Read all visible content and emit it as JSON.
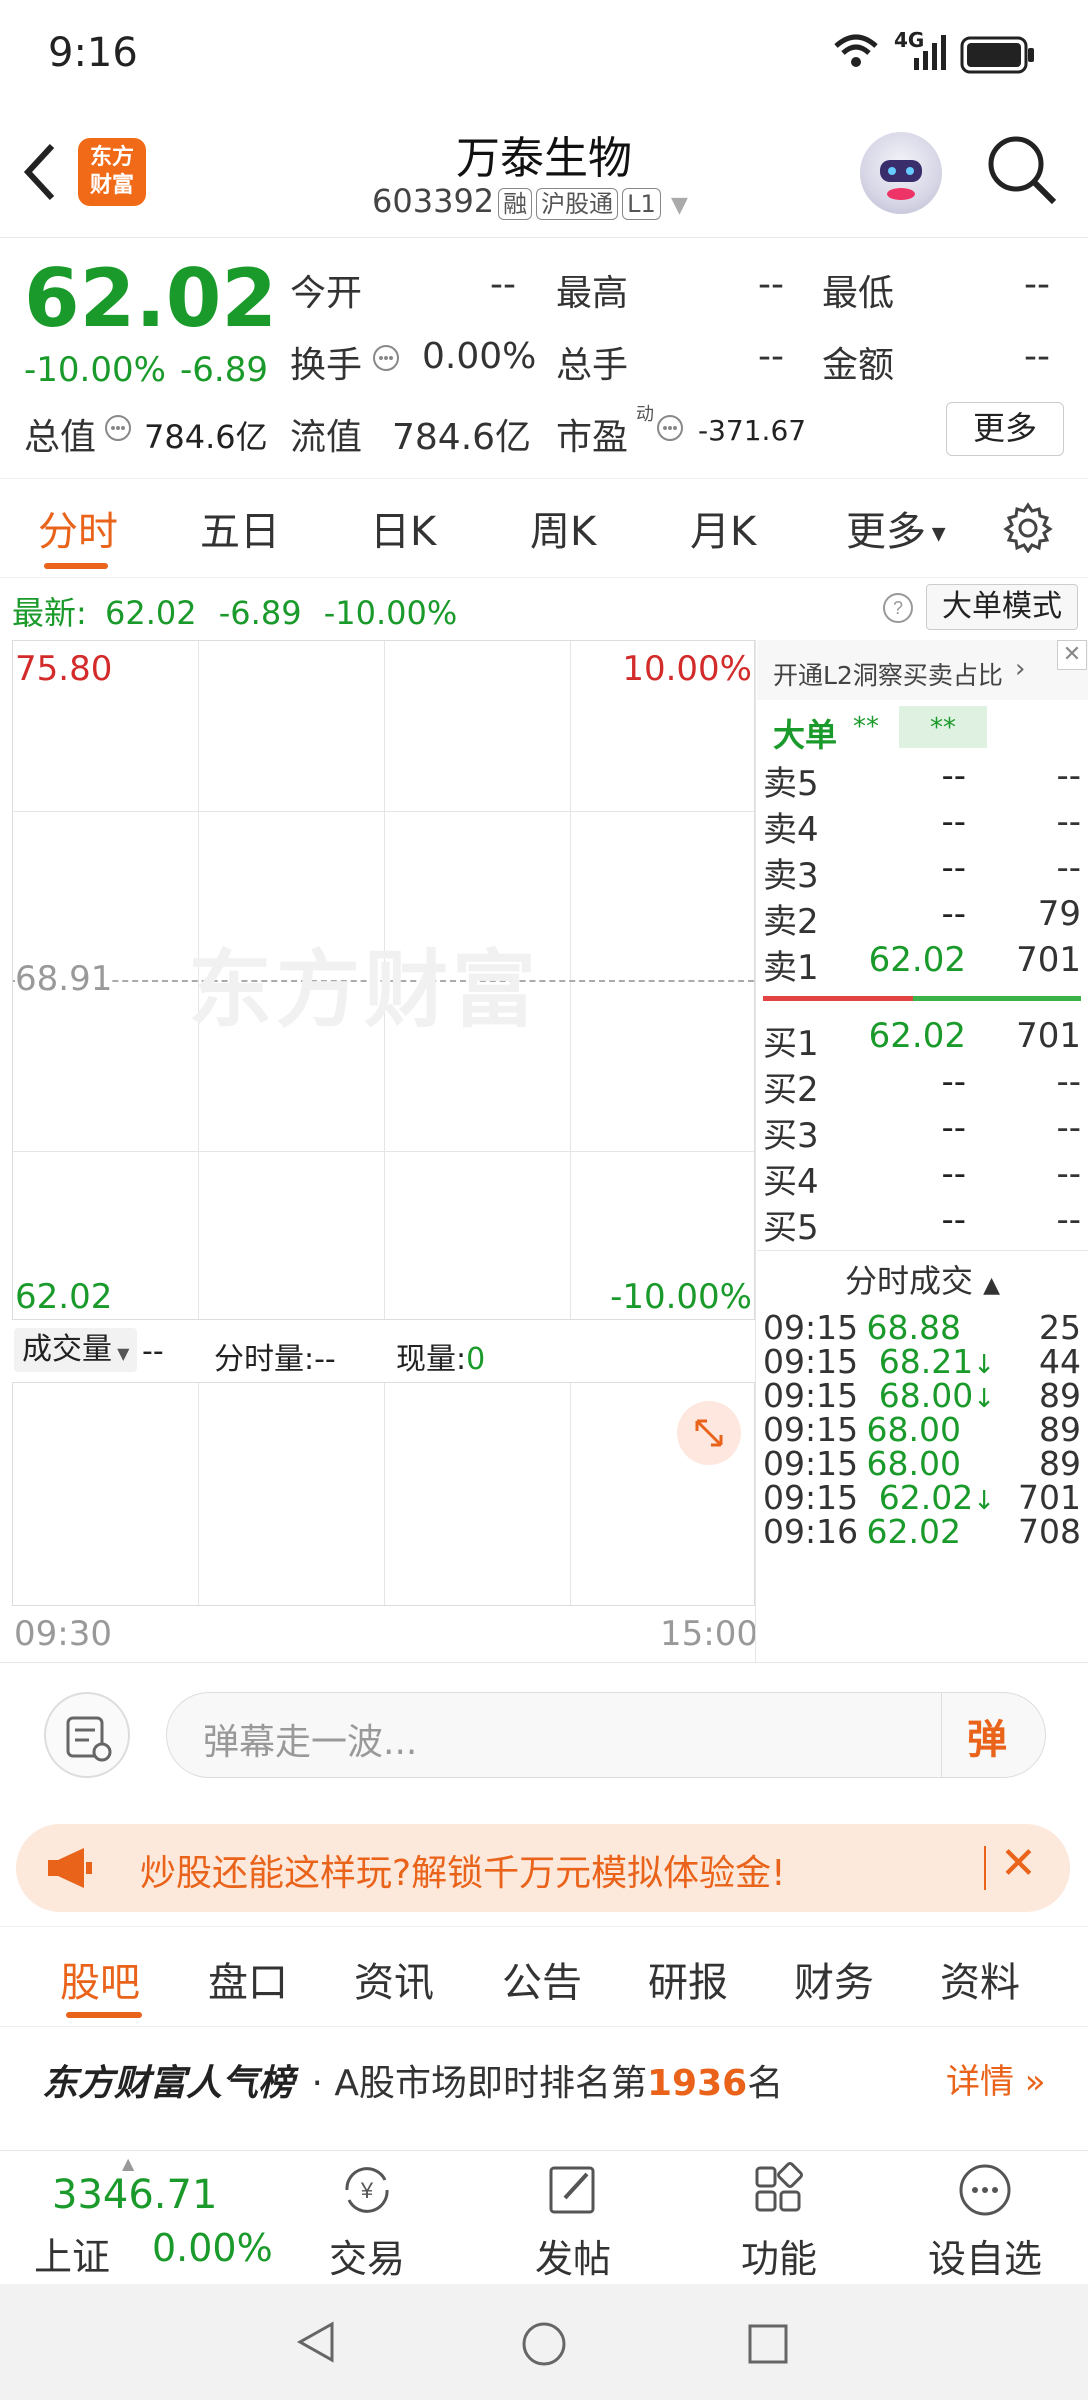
{
  "status_bar": {
    "time": "9:16",
    "network": "4G"
  },
  "header": {
    "title": "万泰生物",
    "code": "603392",
    "tags": [
      "融",
      "沪股通",
      "L1"
    ],
    "logo_text": "东方财富"
  },
  "quote": {
    "price": "62.02",
    "change_pct": "-10.00%",
    "change": "-6.89",
    "open_label": "今开",
    "open_value": "--",
    "high_label": "最高",
    "high_value": "--",
    "low_label": "最低",
    "low_value": "--",
    "turnover_label": "换手",
    "turnover_value": "0.00%",
    "volume_label": "总手",
    "volume_value": "--",
    "amount_label": "金额",
    "amount_value": "--",
    "mcap_label": "总值",
    "mcap_value": "784.6亿",
    "float_label": "流值",
    "float_value": "784.6亿",
    "pe_label": "市盈",
    "pe_sup": "动",
    "pe_value": "-371.67",
    "more_button": "更多"
  },
  "tabs": [
    "分时",
    "五日",
    "日K",
    "周K",
    "月K",
    "更多"
  ],
  "latest_bar": {
    "label": "最新:",
    "price": "62.02",
    "change": "-6.89",
    "pct": "-10.00%",
    "mode_button": "大单模式"
  },
  "chart": {
    "y_max": "75.80",
    "y_mid": "68.91",
    "y_min": "62.02",
    "pct_max": "10.00%",
    "pct_min": "-10.00%",
    "watermark": "东方财富",
    "time_start": "09:30",
    "time_end": "15:00",
    "volume_dropdown": "成交量",
    "volume_value": "--",
    "minute_volume_label": "分时量:",
    "minute_volume_value": "--",
    "current_volume_label": "现量:",
    "current_volume_value": "0"
  },
  "chart_data": {
    "type": "line",
    "title": "",
    "xlabel": "",
    "ylabel": "",
    "x_range": [
      "09:30",
      "15:00"
    ],
    "ylim": [
      62.02,
      75.8
    ],
    "reference_line": 68.91,
    "series": []
  },
  "order_book": {
    "l2_banner": "开通L2洞察买卖占比",
    "big_order_label": "大单",
    "big_order_v1": "**",
    "big_order_v2": "**",
    "asks": [
      {
        "label": "卖5",
        "price": "--",
        "vol": "--"
      },
      {
        "label": "卖4",
        "price": "--",
        "vol": "--"
      },
      {
        "label": "卖3",
        "price": "--",
        "vol": "--"
      },
      {
        "label": "卖2",
        "price": "--",
        "vol": "79"
      },
      {
        "label": "卖1",
        "price": "62.02",
        "vol": "701"
      }
    ],
    "bids": [
      {
        "label": "买1",
        "price": "62.02",
        "vol": "701"
      },
      {
        "label": "买2",
        "price": "--",
        "vol": "--"
      },
      {
        "label": "买3",
        "price": "--",
        "vol": "--"
      },
      {
        "label": "买4",
        "price": "--",
        "vol": "--"
      },
      {
        "label": "买5",
        "price": "--",
        "vol": "--"
      }
    ],
    "trades_title": "分时成交",
    "trades": [
      {
        "time": "09:15",
        "price": "68.88",
        "arrow": "",
        "vol": "25"
      },
      {
        "time": "09:15",
        "price": "68.21",
        "arrow": "↓",
        "vol": "44"
      },
      {
        "time": "09:15",
        "price": "68.00",
        "arrow": "↓",
        "vol": "89"
      },
      {
        "time": "09:15",
        "price": "68.00",
        "arrow": "",
        "vol": "89"
      },
      {
        "time": "09:15",
        "price": "68.00",
        "arrow": "",
        "vol": "89"
      },
      {
        "time": "09:15",
        "price": "62.02",
        "arrow": "↓",
        "vol": "701"
      },
      {
        "time": "09:16",
        "price": "62.02",
        "arrow": "",
        "vol": "708"
      }
    ]
  },
  "comment": {
    "placeholder": "弹幕走一波...",
    "send_glyph": "弹"
  },
  "promo": {
    "text": "炒股还能这样玩?解锁千万元模拟体验金!"
  },
  "bottom_tabs": [
    "股吧",
    "盘口",
    "资讯",
    "公告",
    "研报",
    "财务",
    "资料"
  ],
  "ranking": {
    "brand": "东方财富人气榜",
    "text_prefix": "· A股市场即时排名第",
    "rank": "1936",
    "text_suffix": "名",
    "detail": "详情"
  },
  "bottom_nav": {
    "index_value": "3346.71",
    "index_name": "上证",
    "index_pct": "0.00%",
    "items": [
      "交易",
      "发帖",
      "功能",
      "设自选"
    ]
  },
  "colors": {
    "brand": "#f06a18",
    "up": "#d32a2a",
    "down": "#1a9a2a"
  }
}
